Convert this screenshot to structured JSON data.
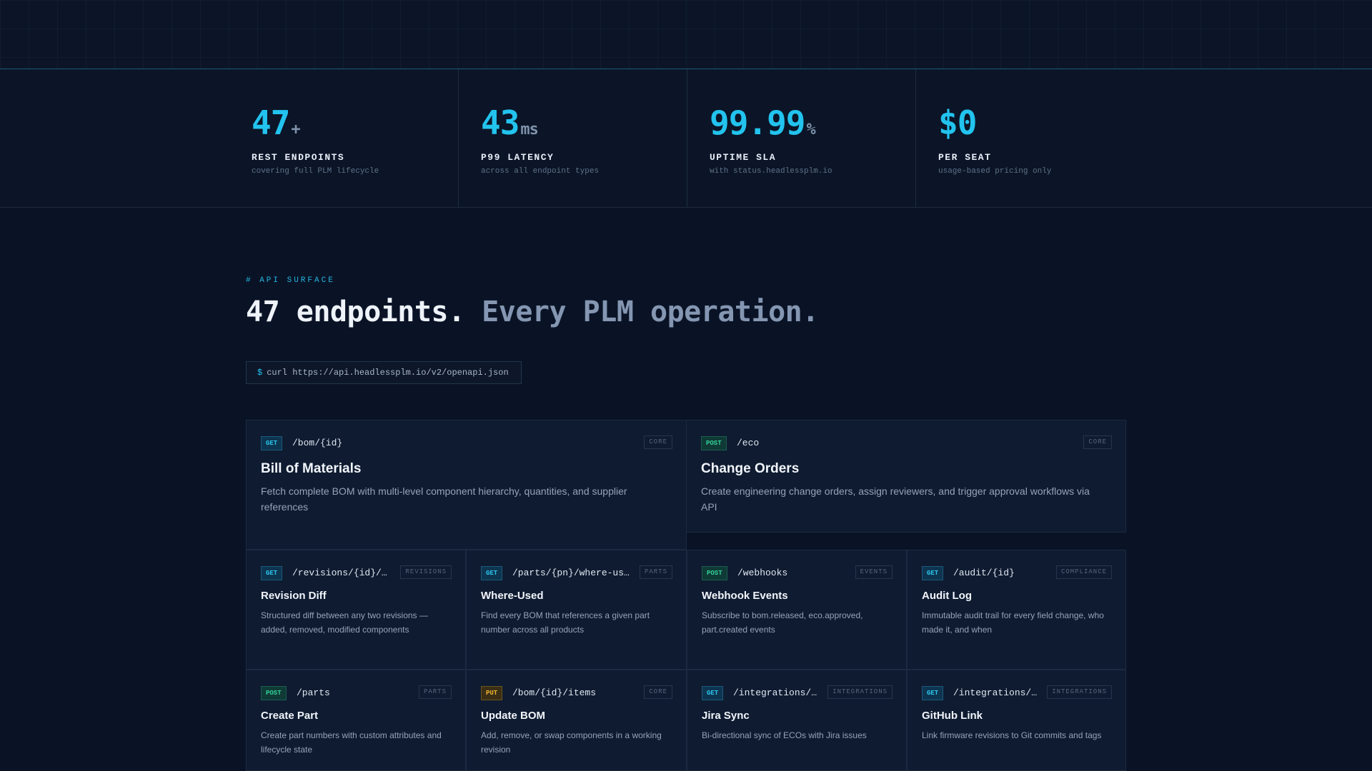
{
  "stats": [
    {
      "value": "47",
      "unit": "+",
      "label": "REST ENDPOINTS",
      "sub": "covering full PLM lifecycle"
    },
    {
      "value": "43",
      "unit": "ms",
      "label": "P99 LATENCY",
      "sub": "across all endpoint types"
    },
    {
      "value": "99.99",
      "unit": "%",
      "label": "UPTIME SLA",
      "sub": "with status.headlessplm.io"
    },
    {
      "value": "$0",
      "unit": "",
      "label": "PER SEAT",
      "sub": "usage-based pricing only"
    }
  ],
  "section": {
    "tag": "# API SURFACE",
    "headline_a": "47 endpoints.",
    "headline_b": "Every PLM operation.",
    "curl_prompt": "$",
    "curl_command": "curl https://api.headlessplm.io/v2/openapi.json"
  },
  "featured": [
    {
      "method": "GET",
      "path": "/bom/{id}",
      "tag": "CORE",
      "title": "Bill of Materials",
      "desc": "Fetch complete BOM with multi-level component hierarchy, quantities, and supplier references"
    },
    {
      "method": "POST",
      "path": "/eco",
      "tag": "CORE",
      "title": "Change Orders",
      "desc": "Create engineering change orders, assign reviewers, and trigger approval workflows via API"
    }
  ],
  "endpoints": [
    {
      "method": "GET",
      "path": "/revisions/{id}/di…",
      "tag": "REVISIONS",
      "title": "Revision Diff",
      "desc": "Structured diff between any two revisions — added, removed, modified components"
    },
    {
      "method": "GET",
      "path": "/parts/{pn}/where-used",
      "tag": "PARTS",
      "title": "Where-Used",
      "desc": "Find every BOM that references a given part number across all products"
    },
    {
      "method": "POST",
      "path": "/webhooks",
      "tag": "EVENTS",
      "title": "Webhook Events",
      "desc": "Subscribe to bom.released, eco.approved, part.created events"
    },
    {
      "method": "GET",
      "path": "/audit/{id}",
      "tag": "COMPLIANCE",
      "title": "Audit Log",
      "desc": "Immutable audit trail for every field change, who made it, and when"
    },
    {
      "method": "POST",
      "path": "/parts",
      "tag": "PARTS",
      "title": "Create Part",
      "desc": "Create part numbers with custom attributes and lifecycle state"
    },
    {
      "method": "PUT",
      "path": "/bom/{id}/items",
      "tag": "CORE",
      "title": "Update BOM",
      "desc": "Add, remove, or swap components in a working revision"
    },
    {
      "method": "GET",
      "path": "/integrations/ji…",
      "tag": "INTEGRATIONS",
      "title": "Jira Sync",
      "desc": "Bi-directional sync of ECOs with Jira issues"
    },
    {
      "method": "GET",
      "path": "/integrations/gi…",
      "tag": "INTEGRATIONS",
      "title": "GitHub Link",
      "desc": "Link firmware revisions to Git commits and tags"
    }
  ]
}
